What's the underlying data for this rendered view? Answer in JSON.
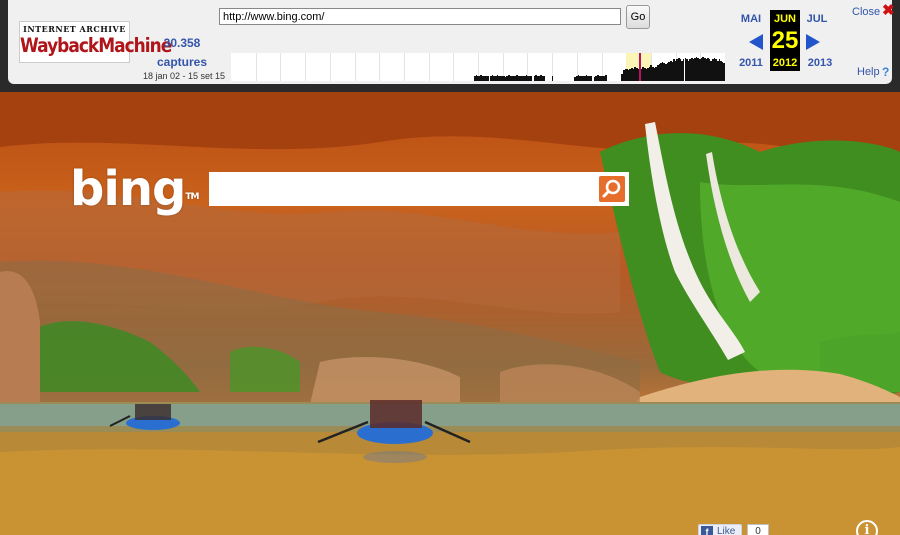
{
  "wayback": {
    "logo": {
      "line1": "INTERNET ARCHIVE",
      "line2": "WaybackMachine"
    },
    "url": "http://www.bing.com/",
    "go_label": "Go",
    "captures": {
      "count": "30.358",
      "label": "captures",
      "range": "18 jan 02 - 15 set 15"
    },
    "calendar": {
      "prev": {
        "month": "MAI",
        "year": "2011"
      },
      "current": {
        "month": "JUN",
        "day": "25",
        "year": "2012"
      },
      "next": {
        "month": "JUL",
        "year": "2013"
      }
    },
    "close_label": "Close",
    "help_label": "Help",
    "sparkline_levels": [
      0,
      0,
      0,
      0,
      0,
      0,
      0,
      0,
      0,
      0,
      0,
      0,
      0,
      0,
      0,
      0,
      0,
      0,
      0,
      0,
      0,
      0,
      0,
      0,
      0,
      0,
      0,
      0,
      0,
      0,
      0,
      0,
      0,
      0,
      0,
      0,
      0,
      0,
      0,
      0,
      0,
      0,
      0,
      0,
      0,
      0,
      0,
      0,
      0,
      0,
      0,
      0,
      0,
      0,
      0,
      0,
      0,
      0,
      0,
      0,
      0,
      0,
      0,
      0,
      0,
      0,
      0,
      0,
      0,
      0,
      0,
      0,
      0,
      0,
      0,
      0,
      0,
      0,
      0,
      0,
      0,
      0,
      0,
      0,
      0,
      0,
      0,
      0,
      0,
      0,
      0,
      0,
      0,
      0,
      0,
      0,
      0,
      0,
      0,
      0,
      0,
      0,
      0,
      0,
      0,
      0,
      0,
      0,
      0,
      0,
      0,
      0,
      0,
      0,
      0,
      0,
      0,
      0,
      0,
      0,
      0,
      0,
      0,
      0,
      0,
      0,
      0,
      0,
      0,
      0,
      0,
      0,
      0,
      0,
      0,
      0,
      0,
      0,
      0,
      0,
      0,
      0,
      0,
      0,
      0,
      0,
      0,
      0,
      0,
      0,
      0.2,
      0.25,
      0.2,
      0.2,
      0.25,
      0.2,
      0.2,
      0.22,
      0.2,
      0,
      0.2,
      0.25,
      0.2,
      0.2,
      0.25,
      0.2,
      0.2,
      0.22,
      0.2,
      0.18,
      0.2,
      0.25,
      0.2,
      0.22,
      0.2,
      0.2,
      0.25,
      0.2,
      0.2,
      0.22,
      0.2,
      0.2,
      0.25,
      0.2,
      0.22,
      0.2,
      0,
      0.2,
      0.25,
      0.2,
      0.2,
      0.25,
      0.2,
      0.2,
      0,
      0,
      0,
      0,
      0.2,
      0,
      0,
      0,
      0,
      0,
      0,
      0,
      0,
      0,
      0,
      0,
      0,
      0,
      0.15,
      0.2,
      0.25,
      0.2,
      0.22,
      0.2,
      0.2,
      0.25,
      0.2,
      0.22,
      0.2,
      0,
      0.18,
      0.2,
      0.25,
      0.2,
      0.22,
      0.2,
      0.2,
      0.25,
      0,
      0,
      0,
      0,
      0,
      0,
      0,
      0,
      0,
      0.3,
      0.45,
      0.5,
      0.5,
      0.45,
      0.5,
      0.55,
      0.5,
      0.6,
      0.55,
      0.5,
      0.55,
      0.5,
      0.6,
      0.55,
      0.5,
      0.55,
      0.6,
      0.65,
      0.6,
      0.55,
      0.6,
      0.65,
      0.7,
      0.75,
      0.8,
      0.75,
      0.7,
      0.75,
      0.8,
      0.85,
      0.8,
      0.9,
      0.85,
      0.9,
      0.95,
      0.9,
      0.85,
      0.9,
      0.95,
      0.9,
      0.85,
      0.9,
      0.95,
      0.9,
      0.95,
      1,
      0.95,
      0.9,
      0.95,
      1,
      0.95,
      0.9,
      0.95,
      0.9,
      0.85,
      0.9,
      0.95,
      0.9,
      0.85,
      0.9,
      0.85,
      0.8,
      0.75
    ]
  },
  "bing": {
    "logo": "bing",
    "trademark": "TM",
    "search_value": "",
    "like_label": "Like",
    "like_count": "0",
    "info_label": "i",
    "colors": {
      "accent": "#e76d2b",
      "fb": "#3b5998"
    }
  }
}
